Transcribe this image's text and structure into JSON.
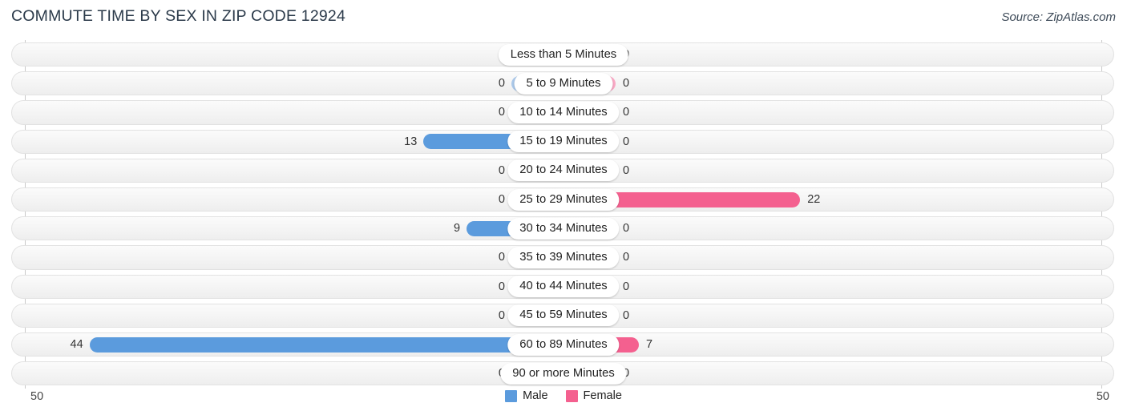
{
  "header": {
    "title": "COMMUTE TIME BY SEX IN ZIP CODE 12924",
    "source": "Source: ZipAtlas.com"
  },
  "axis": {
    "left_tick": "50",
    "right_tick": "50"
  },
  "legend": {
    "items": [
      {
        "label": "Male",
        "color": "#5b9bdd"
      },
      {
        "label": "Female",
        "color": "#f4608f"
      }
    ]
  },
  "colors": {
    "male_strong": "#5b9bdd",
    "male_light": "#aac8ea",
    "female_strong": "#f4608f",
    "female_light": "#f9a8c4",
    "track": "#f4f4f4",
    "title": "#2b3a4a"
  },
  "chart_data": {
    "type": "bar",
    "title": "COMMUTE TIME BY SEX IN ZIP CODE 12924",
    "subtitle": "Source: ZipAtlas.com",
    "orientation": "horizontal-diverging",
    "xlabel": "",
    "ylabel": "",
    "xlim": [
      50,
      50
    ],
    "axis_max": 50,
    "grid": false,
    "legend_position": "bottom-center",
    "categories": [
      "Less than 5 Minutes",
      "5 to 9 Minutes",
      "10 to 14 Minutes",
      "15 to 19 Minutes",
      "20 to 24 Minutes",
      "25 to 29 Minutes",
      "30 to 34 Minutes",
      "35 to 39 Minutes",
      "40 to 44 Minutes",
      "45 to 59 Minutes",
      "60 to 89 Minutes",
      "90 or more Minutes"
    ],
    "series": [
      {
        "name": "Male",
        "values": [
          0,
          0,
          0,
          13,
          0,
          0,
          9,
          0,
          0,
          0,
          44,
          0
        ],
        "labels": [
          "0",
          "0",
          "0",
          "13",
          "0",
          "0",
          "9",
          "0",
          "0",
          "0",
          "44",
          "0"
        ]
      },
      {
        "name": "Female",
        "values": [
          0,
          0,
          0,
          0,
          0,
          22,
          0,
          0,
          0,
          0,
          7,
          0
        ],
        "labels": [
          "0",
          "0",
          "0",
          "0",
          "0",
          "22",
          "0",
          "0",
          "0",
          "0",
          "7",
          "0"
        ]
      }
    ]
  }
}
